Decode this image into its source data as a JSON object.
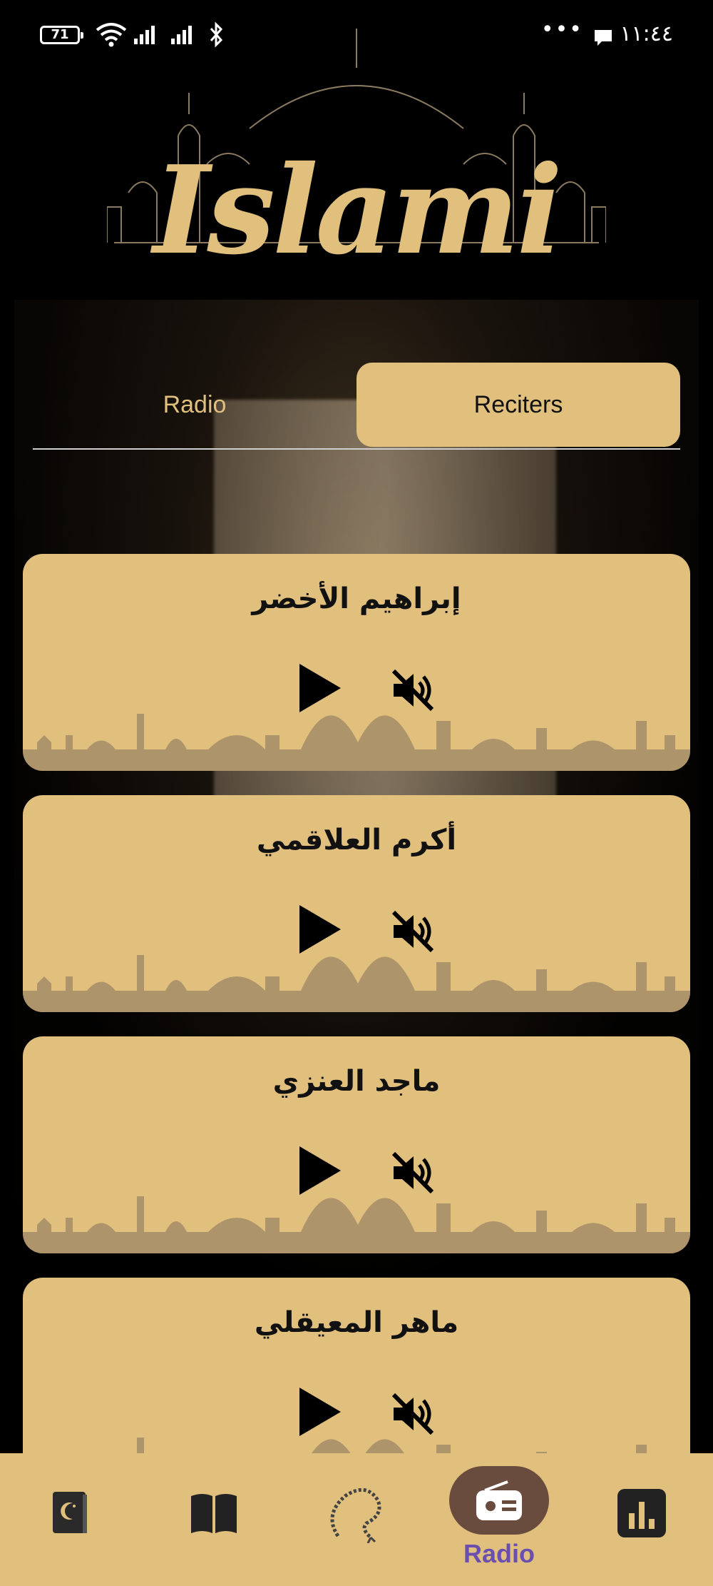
{
  "status_bar": {
    "battery": "71",
    "time": "١١:٤٤",
    "more": "•••"
  },
  "header": {
    "logo_text": "Islami"
  },
  "tabs": [
    {
      "label": "Radio",
      "selected": false
    },
    {
      "label": "Reciters",
      "selected": true
    }
  ],
  "reciters": [
    {
      "name": "إبراهيم الأخضر"
    },
    {
      "name": "أكرم العلاقمي"
    },
    {
      "name": "ماجد العنزي"
    },
    {
      "name": "ماهر المعيقلي"
    }
  ],
  "bottom_nav": {
    "items": [
      {
        "icon": "quran-icon",
        "label": ""
      },
      {
        "icon": "book-icon",
        "label": ""
      },
      {
        "icon": "sebha-icon",
        "label": ""
      },
      {
        "icon": "radio-icon",
        "label": "Radio",
        "selected": true
      },
      {
        "icon": "stats-icon",
        "label": ""
      }
    ],
    "active_label": "Radio"
  },
  "colors": {
    "accent": "#e1bf7d",
    "background": "#000000",
    "nav_active_pill": "#6a4c3f",
    "nav_active_label": "#6b4fae"
  }
}
